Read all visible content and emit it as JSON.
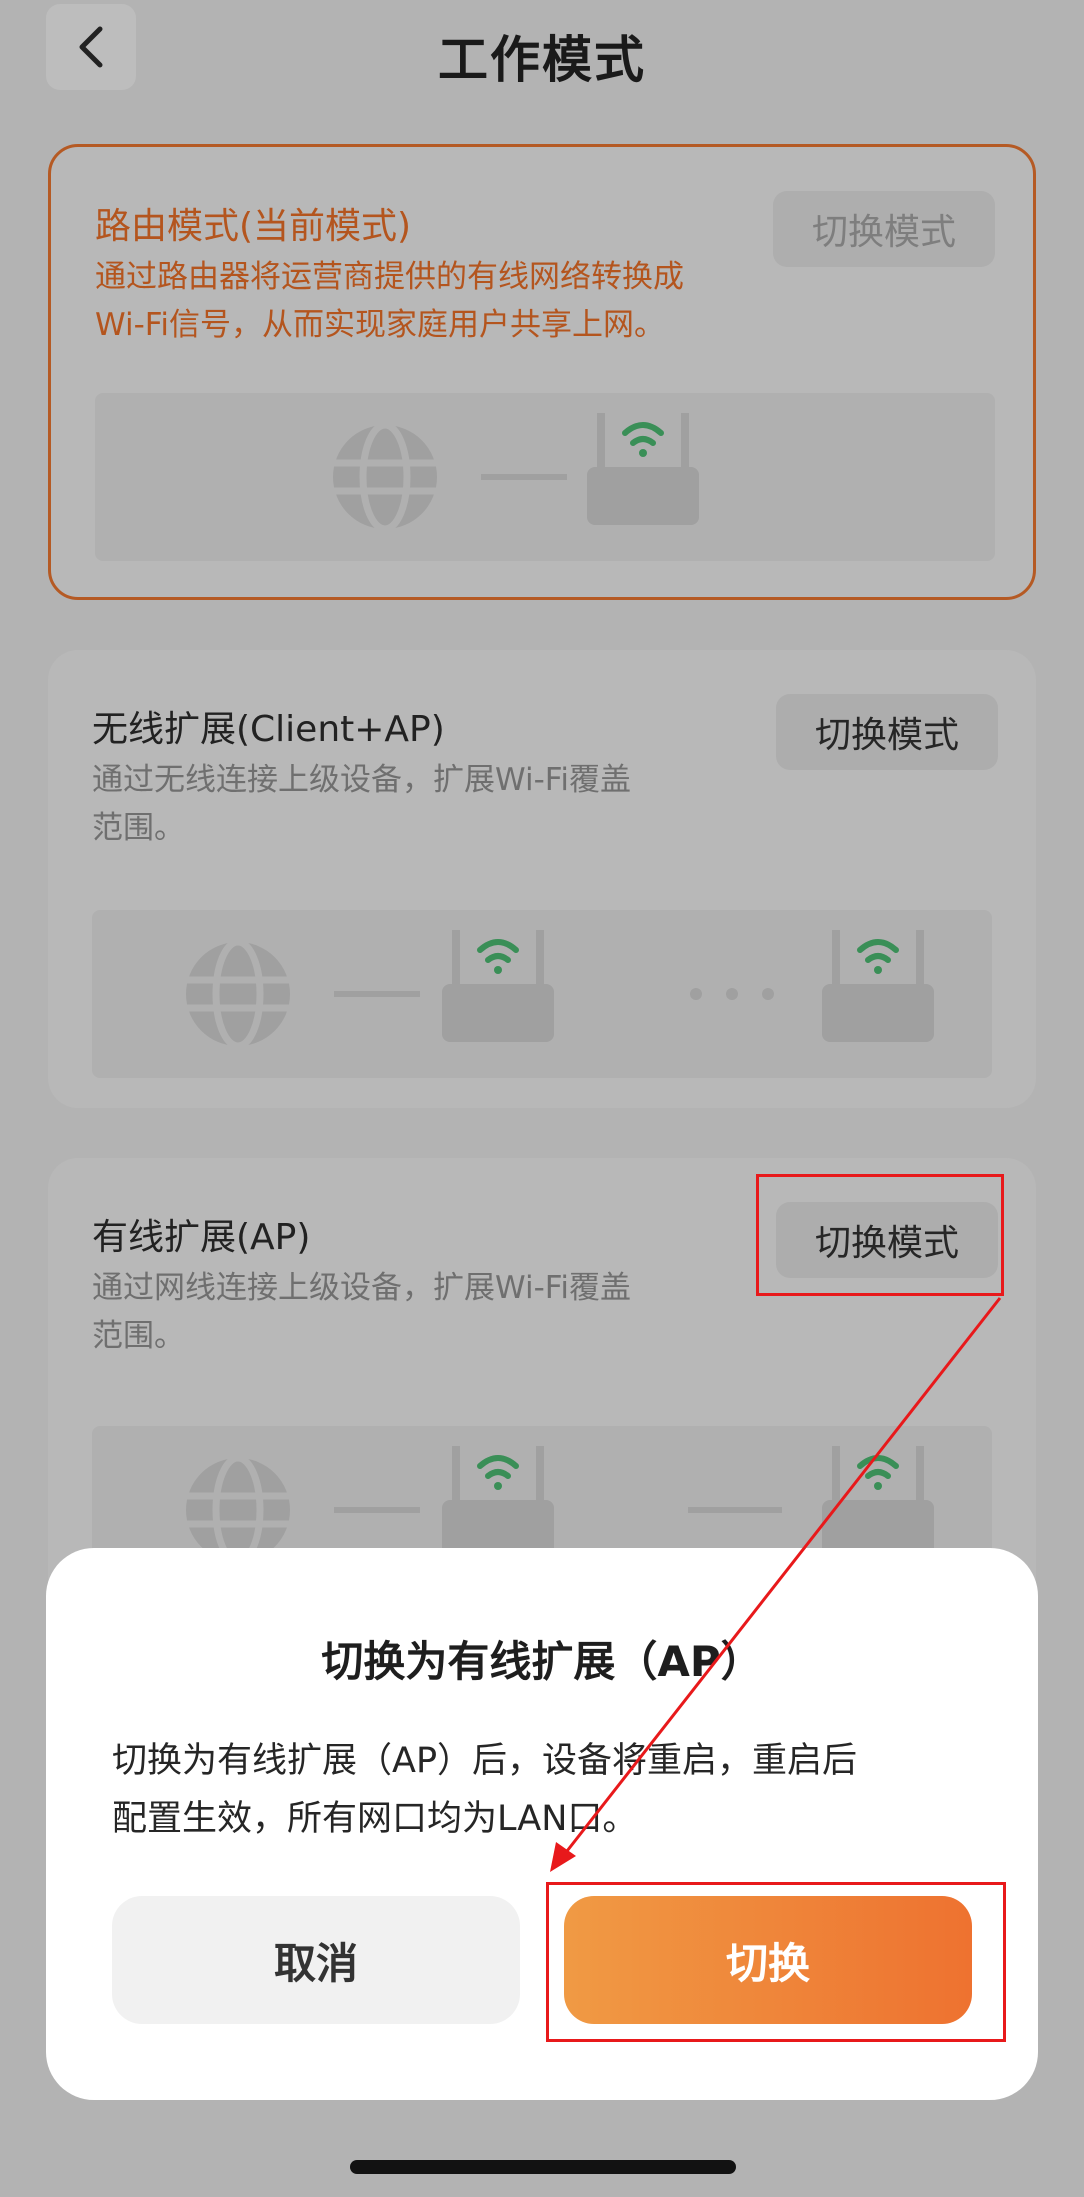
{
  "header": {
    "title": "工作模式"
  },
  "modes": [
    {
      "title": "路由模式(当前模式)",
      "desc_lines": [
        "通过路由器将运营商提供的有线网络转换成",
        "Wi-Fi信号，从而实现家庭用户共享上网。"
      ],
      "button": "切换模式"
    },
    {
      "title": "无线扩展(Client+AP)",
      "desc_lines": [
        "通过无线连接上级设备，扩展Wi-Fi覆盖",
        "范围。"
      ],
      "button": "切换模式"
    },
    {
      "title": "有线扩展(AP)",
      "desc_lines": [
        "通过网线连接上级设备，扩展Wi-Fi覆盖",
        "范围。"
      ],
      "button": "切换模式"
    }
  ],
  "dialog": {
    "title": "切换为有线扩展（AP）",
    "body_lines": [
      "切换为有线扩展（AP）后，设备将重启，重启后",
      "配置生效，所有网口均为LAN口。"
    ],
    "cancel": "取消",
    "confirm": "切换"
  },
  "colors": {
    "accent": "#ee7a35",
    "annotation": "#e8191b",
    "wifi": "#3a8f57"
  }
}
